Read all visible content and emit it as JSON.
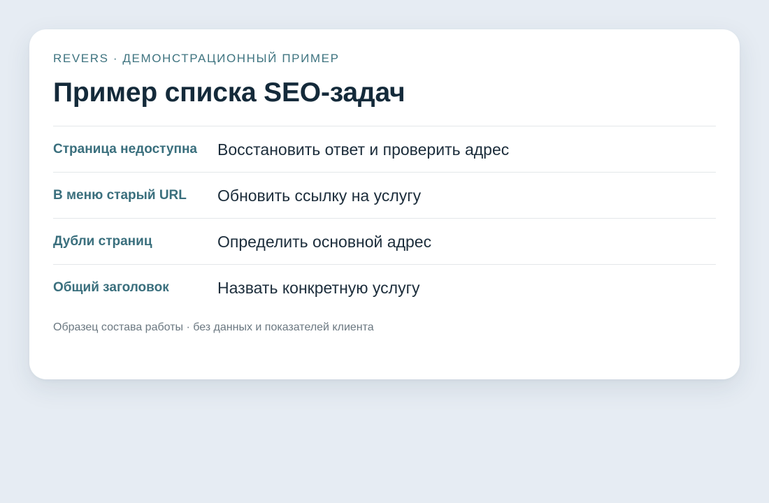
{
  "eyebrow": "REVERS · ДЕМОНСТРАЦИОННЫЙ ПРИМЕР",
  "title": "Пример списка SEO-задач",
  "rows": [
    {
      "issue": "Страница недоступна",
      "action": "Восстановить ответ и проверить адрес"
    },
    {
      "issue": "В меню старый URL",
      "action": "Обновить ссылку на услугу"
    },
    {
      "issue": "Дубли страниц",
      "action": "Определить основной адрес"
    },
    {
      "issue": "Общий заголовок",
      "action": "Назвать конкретную услугу"
    }
  ],
  "footnote": "Образец состава работы · без данных и показателей клиента",
  "colors": {
    "background": "#e6ecf3",
    "card": "#ffffff",
    "title": "#142a3a",
    "issue_label": "#3a6f7d",
    "eyebrow": "#3f7480",
    "footnote": "#6b7881"
  }
}
